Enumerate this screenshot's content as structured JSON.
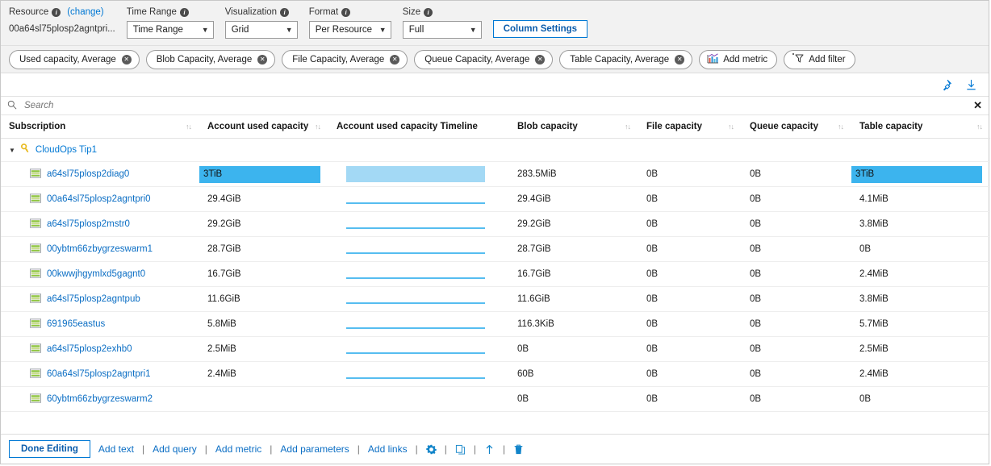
{
  "controls": {
    "resource": {
      "label": "Resource",
      "info_icon": "info-icon",
      "change_link": "(change)",
      "value": "00a64sl75plosp2agntpri..."
    },
    "time_range": {
      "label": "Time Range",
      "info_icon": "info-icon",
      "value": "Time Range"
    },
    "visualization": {
      "label": "Visualization",
      "info_icon": "info-icon",
      "value": "Grid"
    },
    "format": {
      "label": "Format",
      "info_icon": "info-icon",
      "value": "Per Resource"
    },
    "size": {
      "label": "Size",
      "info_icon": "info-icon",
      "value": "Full"
    },
    "column_settings": "Column Settings"
  },
  "chips": [
    {
      "label": "Used capacity, Average",
      "icon": "close-circle-icon"
    },
    {
      "label": "Blob Capacity, Average",
      "icon": "close-circle-icon"
    },
    {
      "label": "File Capacity, Average",
      "icon": "close-circle-icon"
    },
    {
      "label": "Queue Capacity, Average",
      "icon": "close-circle-icon"
    },
    {
      "label": "Table Capacity, Average",
      "icon": "close-circle-icon"
    }
  ],
  "chip_actions": [
    {
      "label": "Add metric",
      "icon": "bar-chart-icon"
    },
    {
      "label": "Add filter",
      "icon": "filter-plus-icon"
    }
  ],
  "grid_tools": [
    {
      "name": "pin-icon"
    },
    {
      "name": "download-icon"
    }
  ],
  "search": {
    "placeholder": "Search",
    "value": "",
    "icon": "search-icon",
    "clear": "✕"
  },
  "table": {
    "columns": [
      {
        "label": "Subscription",
        "sortable": true
      },
      {
        "label": "Account used capacity",
        "sortable": true
      },
      {
        "label": "Account used capacity Timeline",
        "sortable": false
      },
      {
        "label": "Blob capacity",
        "sortable": true
      },
      {
        "label": "File capacity",
        "sortable": true
      },
      {
        "label": "Queue capacity",
        "sortable": true
      },
      {
        "label": "Table capacity",
        "sortable": true
      }
    ],
    "group": {
      "name": "CloudOps Tip1",
      "icon": "key-icon",
      "expanded": true
    },
    "rows": [
      {
        "resource": "a64sl75plosp2diag0",
        "used": "3TiB",
        "used_selected": true,
        "timeline": "filled",
        "blob": "283.5MiB",
        "file": "0B",
        "queue": "0B",
        "table": "3TiB",
        "table_selected": true
      },
      {
        "resource": "00a64sl75plosp2agntpri0",
        "used": "29.4GiB",
        "used_selected": false,
        "timeline": "flat",
        "blob": "29.4GiB",
        "file": "0B",
        "queue": "0B",
        "table": "4.1MiB",
        "table_selected": false
      },
      {
        "resource": "a64sl75plosp2mstr0",
        "used": "29.2GiB",
        "used_selected": false,
        "timeline": "flat",
        "blob": "29.2GiB",
        "file": "0B",
        "queue": "0B",
        "table": "3.8MiB",
        "table_selected": false
      },
      {
        "resource": "00ybtm66zbygrzeswarm1",
        "used": "28.7GiB",
        "used_selected": false,
        "timeline": "flat",
        "blob": "28.7GiB",
        "file": "0B",
        "queue": "0B",
        "table": "0B",
        "table_selected": false
      },
      {
        "resource": "00kwwjhgymlxd5gagnt0",
        "used": "16.7GiB",
        "used_selected": false,
        "timeline": "flat",
        "blob": "16.7GiB",
        "file": "0B",
        "queue": "0B",
        "table": "2.4MiB",
        "table_selected": false
      },
      {
        "resource": "a64sl75plosp2agntpub",
        "used": "11.6GiB",
        "used_selected": false,
        "timeline": "flat",
        "blob": "11.6GiB",
        "file": "0B",
        "queue": "0B",
        "table": "3.8MiB",
        "table_selected": false
      },
      {
        "resource": "691965eastus",
        "used": "5.8MiB",
        "used_selected": false,
        "timeline": "flat",
        "blob": "116.3KiB",
        "file": "0B",
        "queue": "0B",
        "table": "5.7MiB",
        "table_selected": false
      },
      {
        "resource": "a64sl75plosp2exhb0",
        "used": "2.5MiB",
        "used_selected": false,
        "timeline": "flat",
        "blob": "0B",
        "file": "0B",
        "queue": "0B",
        "table": "2.5MiB",
        "table_selected": false
      },
      {
        "resource": "60a64sl75plosp2agntpri1",
        "used": "2.4MiB",
        "used_selected": false,
        "timeline": "flat",
        "blob": "60B",
        "file": "0B",
        "queue": "0B",
        "table": "2.4MiB",
        "table_selected": false
      },
      {
        "resource": "60ybtm66zbygrzeswarm2",
        "used": "",
        "used_selected": false,
        "timeline": "none",
        "blob": "0B",
        "file": "0B",
        "queue": "0B",
        "table": "0B",
        "table_selected": false
      }
    ]
  },
  "footer": {
    "done_button": "Done Editing",
    "links": [
      "Add text",
      "Add query",
      "Add metric",
      "Add parameters",
      "Add links"
    ],
    "separator": "|",
    "icons": [
      {
        "name": "gear-icon"
      },
      {
        "name": "copy-icon"
      },
      {
        "name": "move-up-icon"
      },
      {
        "name": "delete-icon"
      }
    ]
  },
  "colors": {
    "accent": "#0078d4",
    "selection": "#3cb4ee",
    "spark": "#56bdf0",
    "spark_fill": "#a3d9f5",
    "link": "#0b6ec4"
  }
}
